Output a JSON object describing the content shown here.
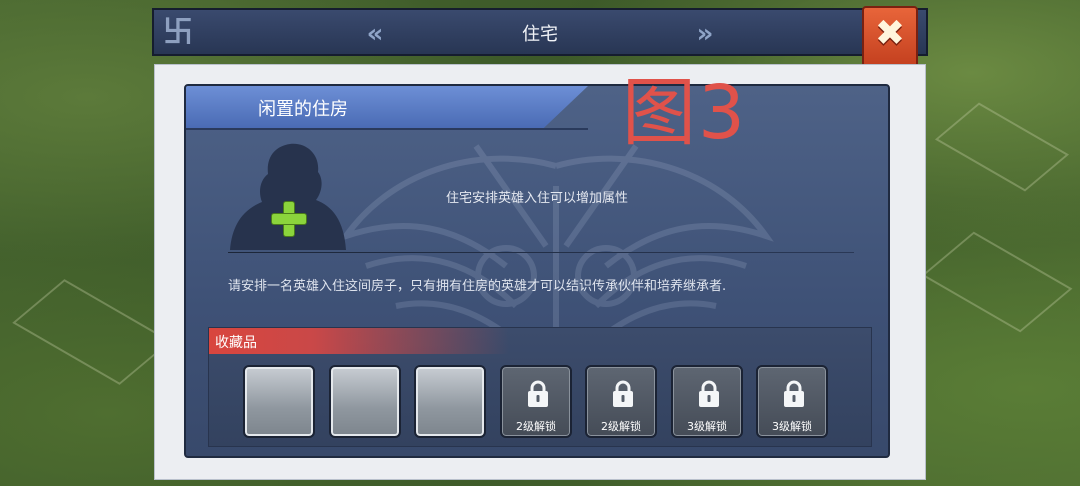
{
  "window": {
    "title": "住宅",
    "prev_icon": "double-chevron-left-icon",
    "next_icon": "double-chevron-right-icon",
    "close_icon": "close-icon",
    "close_glyph": "✖"
  },
  "watermark": "图3",
  "housing": {
    "header": "闲置的住房",
    "hero_slot_icon": "add-icon",
    "info": "住宅安排英雄入住可以增加属性",
    "description": "请安排一名英雄入住这间房子，只有拥有住房的英雄才可以结识传承伙伴和培养继承者."
  },
  "collection": {
    "label": "收藏品",
    "slots": [
      {
        "state": "empty",
        "label": ""
      },
      {
        "state": "empty",
        "label": ""
      },
      {
        "state": "empty",
        "label": ""
      },
      {
        "state": "locked",
        "label": "2级解锁",
        "icon": "lock-icon"
      },
      {
        "state": "locked",
        "label": "2级解锁",
        "icon": "lock-icon"
      },
      {
        "state": "locked",
        "label": "3级解锁",
        "icon": "lock-icon"
      },
      {
        "state": "locked",
        "label": "3级解锁",
        "icon": "lock-icon"
      }
    ]
  },
  "colors": {
    "panel": "#4e6287",
    "header_tab": "#6d8fd6",
    "close_button": "#e8653a",
    "collect_header": "#d9463e",
    "plus": "#8bd43c",
    "watermark": "#e0524a"
  }
}
